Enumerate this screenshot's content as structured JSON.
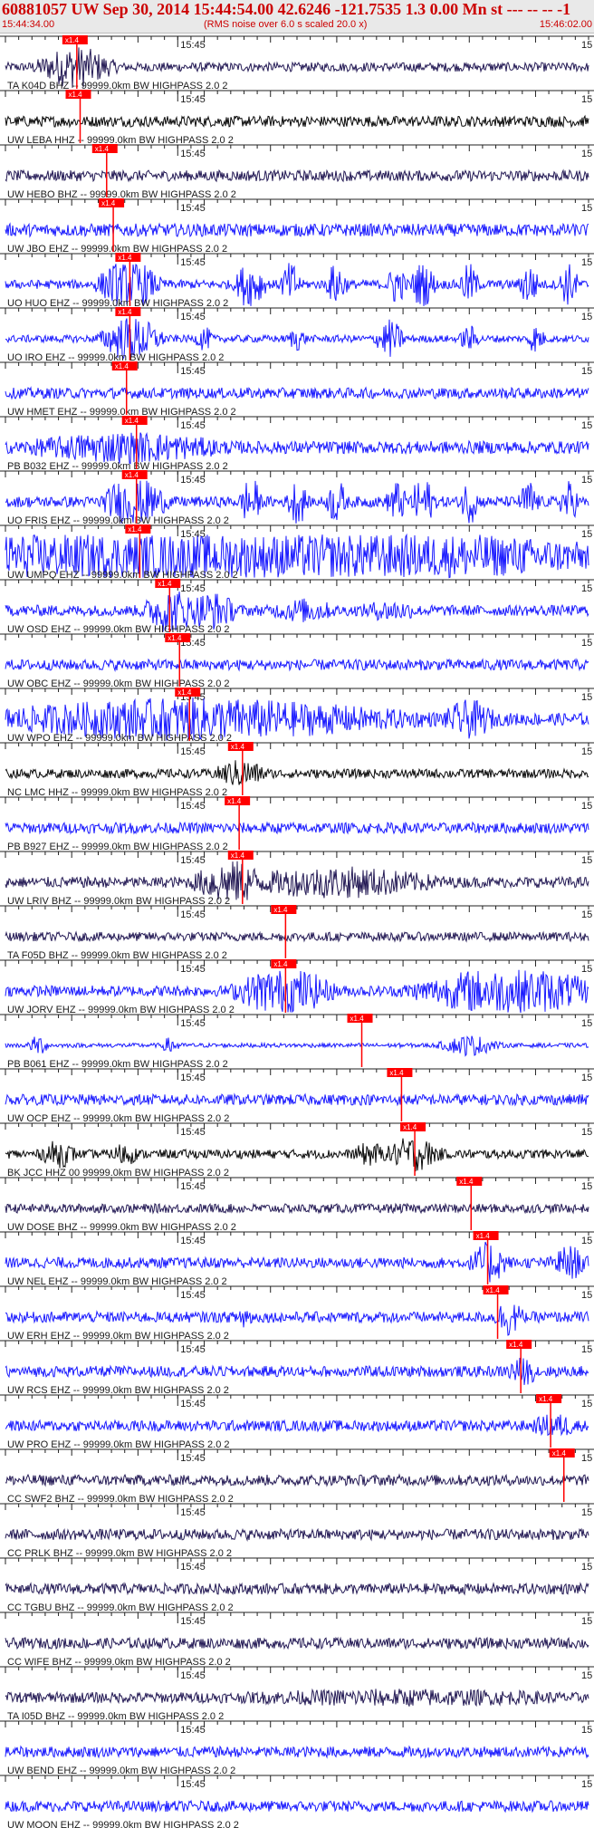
{
  "header": {
    "title": "60881057 UW Sep 30, 2014 15:44:54.00   42.6246 -121.7535  1.3 0.00 Mn st --- -- --  -1",
    "start_time": "15:44:34.00",
    "note": "(RMS noise over 6.0 s scaled 20.0 x)",
    "end_time": "15:46:02.00"
  },
  "colors": {
    "trace_blue": "#1a1aff",
    "trace_black": "#0a0a0a",
    "trace_dark": "#241a55",
    "pick_red": "#ff0000",
    "text": "#1a1a1a",
    "header_red": "#cc0000"
  },
  "chart_data": {
    "type": "seismogram",
    "time_start": "15:44:34.00",
    "time_end": "15:46:02.00",
    "duration_s": 88,
    "minute_mark": {
      "label": "15:45",
      "time_s": 26
    },
    "pick_label": "x1.4",
    "edge_label": "15",
    "traces": [
      {
        "label": "TA K04D BHZ -- 99999.0km BW  HIGHPASS  2.0  2",
        "color": "trace_dark",
        "pick_s": 10.5,
        "amp": 0.25,
        "bursts": [
          [
            10.5,
            4,
            1.2
          ]
        ]
      },
      {
        "label": "UW LEBA HHZ -- 99999.0km BW  HIGHPASS  2.0  2",
        "color": "trace_black",
        "pick_s": 11,
        "amp": 0.3,
        "bursts": []
      },
      {
        "label": "UW HEBO BHZ -- 99999.0km BW  HIGHPASS  2.0  2",
        "color": "trace_dark",
        "pick_s": 15,
        "amp": 0.3,
        "bursts": []
      },
      {
        "label": "UW JBO EHZ -- 99999.0km BW  HIGHPASS  2.0  2",
        "color": "trace_blue",
        "pick_s": 16,
        "amp": 0.35,
        "bursts": []
      },
      {
        "label": "UO HUO EHZ -- 99999.0km BW  HIGHPASS  2.0  2",
        "color": "trace_blue",
        "pick_s": 18.5,
        "amp": 0.25,
        "bursts": [
          [
            18.5,
            3,
            1.6
          ],
          [
            37,
            1.5,
            1.5
          ],
          [
            43,
            1,
            1.4
          ],
          [
            50,
            1,
            1.4
          ],
          [
            59,
            1,
            1.2
          ],
          [
            63,
            1.2,
            1.5
          ],
          [
            70,
            1,
            1.2
          ],
          [
            79,
            1,
            1.3
          ],
          [
            85,
            1,
            1.3
          ]
        ]
      },
      {
        "label": "UO IRO EHZ -- 99999.0km BW  HIGHPASS  2.0  2",
        "color": "trace_blue",
        "pick_s": 18.5,
        "amp": 0.2,
        "bursts": [
          [
            19,
            3,
            1.4
          ],
          [
            30,
            1,
            0.7
          ],
          [
            44,
            1,
            0.7
          ],
          [
            58,
            1.5,
            1.1
          ],
          [
            70,
            1,
            0.8
          ],
          [
            80,
            1,
            0.8
          ]
        ]
      },
      {
        "label": "UW HMET EHZ -- 99999.0km BW  HIGHPASS  2.0  2",
        "color": "trace_blue",
        "pick_s": 18,
        "amp": 0.3,
        "bursts": []
      },
      {
        "label": "PB B032 EHZ -- 99999.0km BW  HIGHPASS  2.0  2",
        "color": "trace_blue",
        "pick_s": 19.5,
        "amp": 0.35,
        "bursts": [
          [
            18,
            12,
            0.9
          ]
        ]
      },
      {
        "label": "UO FRIS EHZ -- 99999.0km BW  HIGHPASS  2.0  2",
        "color": "trace_blue",
        "pick_s": 19.5,
        "amp": 0.3,
        "bursts": [
          [
            19.5,
            3,
            1.8
          ],
          [
            37,
            1,
            1.6
          ],
          [
            44,
            1,
            1.5
          ],
          [
            50,
            1,
            1.4
          ],
          [
            59,
            1,
            1.4
          ],
          [
            63,
            1.2,
            1.6
          ],
          [
            70,
            1,
            1.3
          ],
          [
            79,
            1,
            1.3
          ],
          [
            85,
            1,
            1.3
          ]
        ]
      },
      {
        "label": "UW UMPQ EHZ -- 99999.0km BW  HIGHPASS  2.0  2",
        "color": "trace_blue",
        "pick_s": 20,
        "amp": 0.7,
        "bursts": [
          [
            18,
            14,
            1.7
          ],
          [
            36,
            40,
            1.8
          ]
        ]
      },
      {
        "label": "UW OSD EHZ -- 99999.0km BW  HIGHPASS  2.0  2",
        "color": "trace_blue",
        "pick_s": 24.5,
        "amp": 0.3,
        "bursts": [
          [
            25,
            3,
            1.3
          ],
          [
            31,
            3,
            1.1
          ],
          [
            45,
            4,
            0.7
          ],
          [
            58,
            4,
            0.6
          ]
        ]
      },
      {
        "label": "UW OBC EHZ -- 99999.0km BW  HIGHPASS  2.0  2",
        "color": "trace_blue",
        "pick_s": 26,
        "amp": 0.3,
        "bursts": []
      },
      {
        "label": "UW WPO EHZ -- 99999.0km BW  HIGHPASS  2.0  2",
        "color": "trace_blue",
        "pick_s": 27.5,
        "amp": 0.35,
        "bursts": [
          [
            28,
            25,
            1.2
          ],
          [
            70,
            3,
            1.1
          ]
        ]
      },
      {
        "label": "NC LMC HHZ -- 99999.0km BW  HIGHPASS  2.0  2",
        "color": "trace_black",
        "pick_s": 35.5,
        "amp": 0.25,
        "bursts": [
          [
            35.5,
            3,
            0.8
          ]
        ]
      },
      {
        "label": "PB B927 EHZ -- 99999.0km BW  HIGHPASS  2.0  2",
        "color": "trace_blue",
        "pick_s": 35,
        "amp": 0.3,
        "bursts": []
      },
      {
        "label": "UW LRIV BHZ -- 99999.0km BW  HIGHPASS  2.0  2",
        "color": "trace_dark",
        "pick_s": 35.5,
        "amp": 0.3,
        "bursts": [
          [
            34,
            4,
            1.3
          ],
          [
            50,
            12,
            0.9
          ]
        ]
      },
      {
        "label": "TA F05D BHZ -- 99999.0km BW  HIGHPASS  2.0  2",
        "color": "trace_dark",
        "pick_s": 42,
        "amp": 0.25,
        "bursts": []
      },
      {
        "label": "UW JORV EHZ -- 99999.0km BW  HIGHPASS  2.0  2",
        "color": "trace_blue",
        "pick_s": 42,
        "amp": 0.3,
        "bursts": [
          [
            42,
            5,
            1.5
          ],
          [
            76,
            10,
            1.4
          ]
        ]
      },
      {
        "label": "PB B061 EHZ -- 99999.0km BW  HIGHPASS  2.0  2",
        "color": "trace_blue",
        "pick_s": 53.5,
        "amp": 0.12,
        "bursts": [
          [
            5,
            1,
            0.6
          ],
          [
            25,
            1,
            0.5
          ],
          [
            70,
            3,
            0.6
          ]
        ]
      },
      {
        "label": "UW OCP EHZ -- 99999.0km BW  HIGHPASS  2.0  2",
        "color": "trace_blue",
        "pick_s": 59.5,
        "amp": 0.3,
        "bursts": []
      },
      {
        "label": "BK JCC HHZ 00 99999.0km BW  HIGHPASS  2.0  2",
        "color": "trace_black",
        "pick_s": 61.5,
        "amp": 0.25,
        "bursts": [
          [
            8,
            2,
            0.8
          ],
          [
            18,
            1.5,
            0.7
          ],
          [
            55,
            2,
            0.7
          ],
          [
            61.5,
            3,
            1.0
          ]
        ]
      },
      {
        "label": "UW DOSE BHZ -- 99999.0km BW  HIGHPASS  2.0  2",
        "color": "trace_dark",
        "pick_s": 70,
        "amp": 0.25,
        "bursts": []
      },
      {
        "label": "UW NEL EHZ -- 99999.0km BW  HIGHPASS  2.0  2",
        "color": "trace_blue",
        "pick_s": 72.5,
        "amp": 0.3,
        "bursts": [
          [
            73,
            2,
            1.2
          ],
          [
            85,
            2,
            1.0
          ]
        ]
      },
      {
        "label": "UW ERH EHZ -- 99999.0km BW  HIGHPASS  2.0  2",
        "color": "trace_blue",
        "pick_s": 74,
        "amp": 0.3,
        "bursts": [
          [
            36,
            1,
            0.8
          ],
          [
            76,
            1.5,
            1.1
          ]
        ]
      },
      {
        "label": "UW RCS EHZ -- 99999.0km BW  HIGHPASS  2.0  2",
        "color": "trace_blue",
        "pick_s": 77.5,
        "amp": 0.3,
        "bursts": [
          [
            78,
            2,
            0.8
          ]
        ]
      },
      {
        "label": "UW PRO EHZ -- 99999.0km BW  HIGHPASS  2.0  2",
        "color": "trace_blue",
        "pick_s": 82,
        "amp": 0.3,
        "bursts": [
          [
            83,
            3,
            0.7
          ]
        ]
      },
      {
        "label": "CC SWF2 BHZ -- 99999.0km BW  HIGHPASS  2.0  2",
        "color": "trace_dark",
        "pick_s": 84,
        "amp": 0.3,
        "bursts": []
      },
      {
        "label": "CC PRLK BHZ -- 99999.0km BW  HIGHPASS  2.0  2",
        "color": "trace_dark",
        "amp": 0.3,
        "bursts": []
      },
      {
        "label": "CC TGBU BHZ -- 99999.0km BW  HIGHPASS  2.0  2",
        "color": "trace_dark",
        "amp": 0.3,
        "bursts": []
      },
      {
        "label": "CC WIFE BHZ -- 99999.0km BW  HIGHPASS  2.0  2",
        "color": "trace_dark",
        "amp": 0.3,
        "bursts": []
      },
      {
        "label": "TA I05D BHZ -- 99999.0km BW  HIGHPASS  2.0  2",
        "color": "trace_dark",
        "amp": 0.3,
        "bursts": [
          [
            60,
            25,
            0.5
          ]
        ]
      },
      {
        "label": "UW BEND EHZ -- 99999.0km BW  HIGHPASS  2.0  2",
        "color": "trace_blue",
        "amp": 0.3,
        "bursts": []
      },
      {
        "label": "UW MOON EHZ -- 99999.0km BW  HIGHPASS  2.0  2",
        "color": "trace_blue",
        "amp": 0.3,
        "bursts": []
      }
    ]
  }
}
